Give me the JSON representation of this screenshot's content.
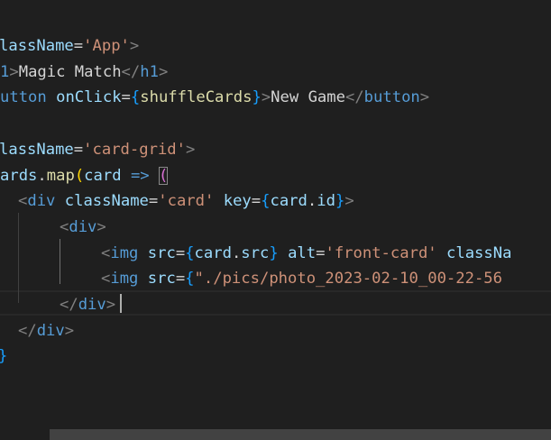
{
  "editor": {
    "lines": [
      {
        "tokens": [
          {
            "c": "attr",
            "t": "lassName"
          },
          {
            "c": "text",
            "t": "="
          },
          {
            "c": "str",
            "t": "'App'"
          },
          {
            "c": "punc",
            "t": ">"
          }
        ]
      },
      {
        "tokens": [
          {
            "c": "tag",
            "t": "1"
          },
          {
            "c": "punc",
            "t": ">"
          },
          {
            "c": "text",
            "t": "Magic Match"
          },
          {
            "c": "punc",
            "t": "</"
          },
          {
            "c": "tag",
            "t": "h1"
          },
          {
            "c": "punc",
            "t": ">"
          }
        ]
      },
      {
        "tokens": [
          {
            "c": "tag",
            "t": "utton"
          },
          {
            "c": "text",
            "t": " "
          },
          {
            "c": "attr",
            "t": "onClick"
          },
          {
            "c": "text",
            "t": "="
          },
          {
            "c": "brace",
            "t": "{"
          },
          {
            "c": "fn",
            "t": "shuffleCards"
          },
          {
            "c": "brace",
            "t": "}"
          },
          {
            "c": "punc",
            "t": ">"
          },
          {
            "c": "text",
            "t": "New Game"
          },
          {
            "c": "punc",
            "t": "</"
          },
          {
            "c": "tag",
            "t": "button"
          },
          {
            "c": "punc",
            "t": ">"
          }
        ]
      },
      {
        "tokens": []
      },
      {
        "tokens": [
          {
            "c": "attr",
            "t": "lassName"
          },
          {
            "c": "text",
            "t": "="
          },
          {
            "c": "str",
            "t": "'card-grid'"
          },
          {
            "c": "punc",
            "t": ">"
          }
        ]
      },
      {
        "tokens": [
          {
            "c": "attr",
            "t": "ards"
          },
          {
            "c": "text",
            "t": "."
          },
          {
            "c": "fn",
            "t": "map"
          },
          {
            "c": "paren",
            "t": "("
          },
          {
            "c": "attr",
            "t": "card"
          },
          {
            "c": "text",
            "t": " "
          },
          {
            "c": "op",
            "t": "=>"
          },
          {
            "c": "text",
            "t": " "
          },
          {
            "c": "paren2",
            "t": "("
          }
        ]
      },
      {
        "tokens": [
          {
            "c": "punc",
            "t": "<"
          },
          {
            "c": "tag",
            "t": "div"
          },
          {
            "c": "text",
            "t": " "
          },
          {
            "c": "attr",
            "t": "className"
          },
          {
            "c": "text",
            "t": "="
          },
          {
            "c": "str",
            "t": "'card'"
          },
          {
            "c": "text",
            "t": " "
          },
          {
            "c": "attr",
            "t": "key"
          },
          {
            "c": "text",
            "t": "="
          },
          {
            "c": "brace",
            "t": "{"
          },
          {
            "c": "attr",
            "t": "card"
          },
          {
            "c": "text",
            "t": "."
          },
          {
            "c": "attr",
            "t": "id"
          },
          {
            "c": "brace",
            "t": "}"
          },
          {
            "c": "punc",
            "t": ">"
          }
        ]
      },
      {
        "tokens": [
          {
            "c": "punc",
            "t": "<"
          },
          {
            "c": "tag",
            "t": "div"
          },
          {
            "c": "punc",
            "t": ">"
          }
        ]
      },
      {
        "tokens": [
          {
            "c": "punc",
            "t": "<"
          },
          {
            "c": "tag",
            "t": "img"
          },
          {
            "c": "text",
            "t": " "
          },
          {
            "c": "attr",
            "t": "src"
          },
          {
            "c": "text",
            "t": "="
          },
          {
            "c": "brace",
            "t": "{"
          },
          {
            "c": "attr",
            "t": "card"
          },
          {
            "c": "text",
            "t": "."
          },
          {
            "c": "attr",
            "t": "src"
          },
          {
            "c": "brace",
            "t": "}"
          },
          {
            "c": "text",
            "t": " "
          },
          {
            "c": "attr",
            "t": "alt"
          },
          {
            "c": "text",
            "t": "="
          },
          {
            "c": "str",
            "t": "'front-card'"
          },
          {
            "c": "text",
            "t": " "
          },
          {
            "c": "attr",
            "t": "classNa"
          }
        ]
      },
      {
        "tokens": [
          {
            "c": "punc",
            "t": "<"
          },
          {
            "c": "tag",
            "t": "img"
          },
          {
            "c": "text",
            "t": " "
          },
          {
            "c": "attr",
            "t": "src"
          },
          {
            "c": "text",
            "t": "="
          },
          {
            "c": "brace",
            "t": "{"
          },
          {
            "c": "str",
            "t": "\"./pics/photo_2023-02-10_00-22-56"
          }
        ]
      },
      {
        "tokens": [
          {
            "c": "punc",
            "t": "</"
          },
          {
            "c": "tag",
            "t": "div"
          },
          {
            "c": "punc",
            "t": ">"
          }
        ]
      },
      {
        "tokens": [
          {
            "c": "punc",
            "t": "</"
          },
          {
            "c": "tag",
            "t": "div"
          },
          {
            "c": "punc",
            "t": ">"
          }
        ]
      },
      {
        "tokens": [
          {
            "c": "brace",
            "t": "}"
          }
        ]
      }
    ]
  }
}
